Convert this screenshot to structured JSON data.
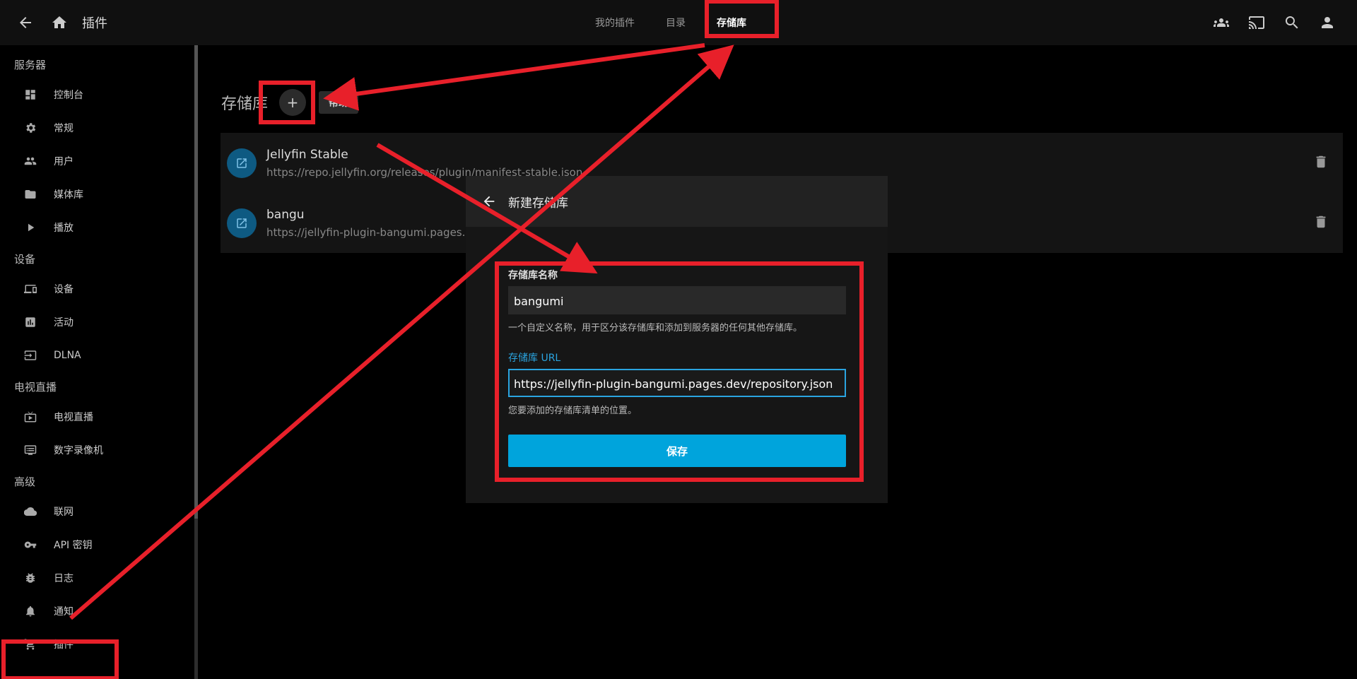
{
  "header": {
    "title": "插件",
    "tabs": [
      {
        "label": "我的插件"
      },
      {
        "label": "目录"
      },
      {
        "label": "存储库"
      }
    ]
  },
  "sidebar": {
    "sections": [
      {
        "title": "服务器",
        "items": [
          {
            "label": "控制台",
            "icon": "dashboard-icon"
          },
          {
            "label": "常规",
            "icon": "gear-icon"
          },
          {
            "label": "用户",
            "icon": "people-icon"
          },
          {
            "label": "媒体库",
            "icon": "folder-icon"
          },
          {
            "label": "播放",
            "icon": "play-icon"
          }
        ]
      },
      {
        "title": "设备",
        "items": [
          {
            "label": "设备",
            "icon": "devices-icon"
          },
          {
            "label": "活动",
            "icon": "activity-icon"
          },
          {
            "label": "DLNA",
            "icon": "dlna-icon"
          }
        ]
      },
      {
        "title": "电视直播",
        "items": [
          {
            "label": "电视直播",
            "icon": "live-tv-icon"
          },
          {
            "label": "数字录像机",
            "icon": "dvr-icon"
          }
        ]
      },
      {
        "title": "高级",
        "items": [
          {
            "label": "联网",
            "icon": "cloud-icon"
          },
          {
            "label": "API 密钥",
            "icon": "key-icon"
          },
          {
            "label": "日志",
            "icon": "bug-icon"
          },
          {
            "label": "通知",
            "icon": "bell-icon"
          },
          {
            "label": "插件",
            "icon": "cart-icon"
          }
        ]
      }
    ]
  },
  "main": {
    "heading": "存储库",
    "add_label": "+",
    "help_label": "帮助",
    "repositories": [
      {
        "name": "Jellyfin Stable",
        "url": "https://repo.jellyfin.org/releases/plugin/manifest-stable.json"
      },
      {
        "name": "bangu",
        "url": "https://jellyfin-plugin-bangumi.pages.de"
      }
    ]
  },
  "dialog": {
    "title": "新建存储库",
    "name_label": "存储库名称",
    "name_value": "bangumi",
    "name_hint": "一个自定义名称，用于区分该存储库和添加到服务器的任何其他存储库。",
    "url_label": "存储库 URL",
    "url_value": "https://jellyfin-plugin-bangumi.pages.dev/repository.json",
    "url_hint": "您要添加的存储库清单的位置。",
    "save_label": "保存"
  },
  "colors": {
    "accent": "#00a4dc",
    "annotation": "#e8202a"
  }
}
